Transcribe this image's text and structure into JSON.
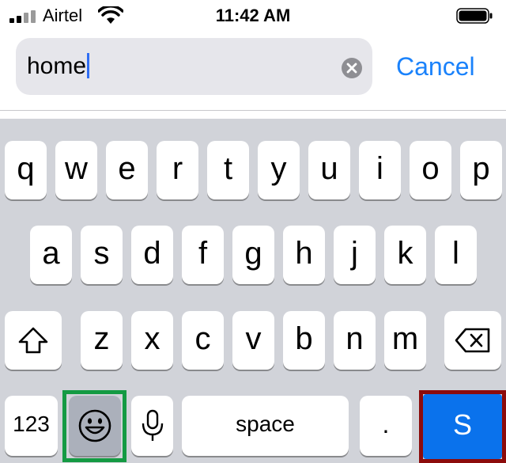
{
  "status_bar": {
    "carrier": "Airtel",
    "time": "11:42 AM"
  },
  "search": {
    "value": "home",
    "cancel_label": "Cancel"
  },
  "keyboard": {
    "row1": [
      "q",
      "w",
      "e",
      "r",
      "t",
      "y",
      "u",
      "i",
      "o",
      "p"
    ],
    "row2": [
      "a",
      "s",
      "d",
      "f",
      "g",
      "h",
      "j",
      "k",
      "l"
    ],
    "row3": [
      "z",
      "x",
      "c",
      "v",
      "b",
      "n",
      "m"
    ],
    "numbers_label": "123",
    "space_label": "space",
    "period_label": ".",
    "return_label": "S"
  },
  "colors": {
    "accent": "#1a82fb",
    "caret": "#2f6df3",
    "keyboard_bg": "#d1d3d9",
    "emoji_highlight": "#149a43",
    "return_highlight": "#8c0b0b",
    "return_key": "#0a72ec"
  }
}
